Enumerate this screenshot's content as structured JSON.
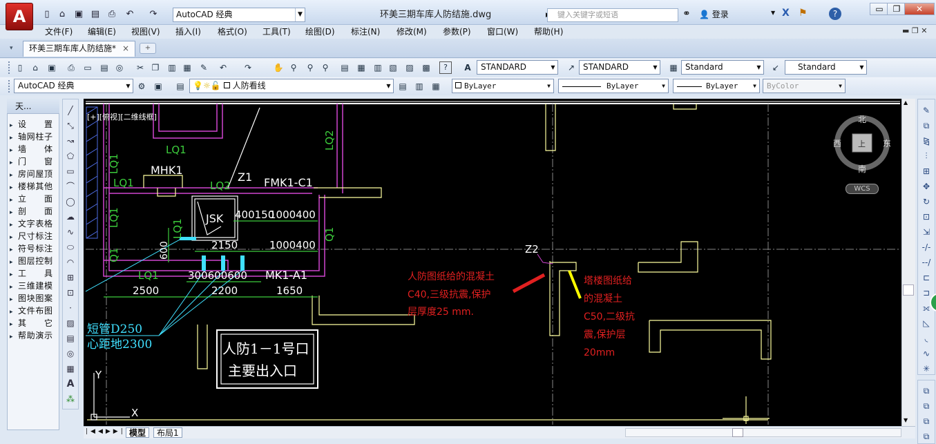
{
  "app": {
    "logo_letter": "A",
    "title": "环美三期车库人防结施.dwg"
  },
  "quick_access": {
    "workspace": "AutoCAD 经典"
  },
  "search": {
    "placeholder": "键入关键字或短语"
  },
  "user": {
    "login_label": "登录"
  },
  "window_controls": {
    "minimize": "▭",
    "restore": "❐",
    "close": "✕"
  },
  "menu": [
    "文件(F)",
    "编辑(E)",
    "视图(V)",
    "插入(I)",
    "格式(O)",
    "工具(T)",
    "绘图(D)",
    "标注(N)",
    "修改(M)",
    "参数(P)",
    "窗口(W)",
    "帮助(H)"
  ],
  "doc_tab": {
    "label": "环美三期车库人防结施*",
    "close": "×"
  },
  "styles_toolbar": {
    "text_style": "STANDARD",
    "dim_style": "STANDARD",
    "table_style": "Standard",
    "mleader_style": "Standard"
  },
  "layers_toolbar": {
    "workspace": "AutoCAD 经典",
    "current_layer": "人防看线"
  },
  "properties_toolbar": {
    "color": "ByLayer",
    "linetype": "ByLayer",
    "lineweight": "ByLayer",
    "plotstyle": "ByColor"
  },
  "left_palette": {
    "title": "天...",
    "items": [
      "设　置",
      "轴网柱子",
      "墙　体",
      "门　窗",
      "房间屋顶",
      "楼梯其他",
      "立　面",
      "剖　面",
      "文字表格",
      "尺寸标注",
      "符号标注",
      "图层控制",
      "工　具",
      "三维建模",
      "图块图案",
      "文件布图",
      "其　它",
      "帮助演示"
    ]
  },
  "viewport": {
    "label": "[+][俯视][二维线框]"
  },
  "viewcube": {
    "north": "北",
    "south": "南",
    "east": "东",
    "west": "西",
    "top": "上",
    "wcs": "WCS"
  },
  "drawing": {
    "beam_labels": [
      "LQ1",
      "LQ1",
      "LQ1",
      "LQ1",
      "LQ1",
      "LQ1",
      "LQ2",
      "LQ2",
      "Q1",
      "Q1"
    ],
    "labels": {
      "mhk1": "MHK1",
      "z1": "Z1",
      "fmk": "FMK1-C1",
      "jsk": "JSK",
      "z2": "Z2",
      "mk1": "MK1-A1",
      "dim_400150": "400150",
      "dim_1000400a": "1000400",
      "dim_2150": "2150",
      "dim_1000400b": "1000400",
      "dim_600": "600",
      "dim_2500": "2500",
      "dim_300600600": "300600600",
      "dim_2200": "2200",
      "dim_1650": "1650"
    },
    "cyan_note": [
      "短管D250",
      "心距地2300"
    ],
    "box_note": [
      "人防1－1号口",
      "主要出入口"
    ],
    "red_note": [
      "人防图纸给的混凝土",
      "C40,三级抗震,保护",
      "层厚度25 mm."
    ],
    "red_note2": [
      "塔楼图纸给",
      "的混凝土",
      "C50,二级抗",
      "震,保护层",
      "20mm"
    ],
    "ucs": {
      "x": "X",
      "y": "Y"
    }
  },
  "layout_tabs": {
    "model": "模型",
    "layout1": "布局1"
  },
  "colors": {
    "canvas": "#000000",
    "cad_yellow": "#ffffa0",
    "cad_magenta": "#d046d0",
    "cad_green": "#3ccc3c",
    "cad_cyan": "#40e0ff",
    "annot_red": "#e02020",
    "annot_yellow": "#ffff00"
  }
}
